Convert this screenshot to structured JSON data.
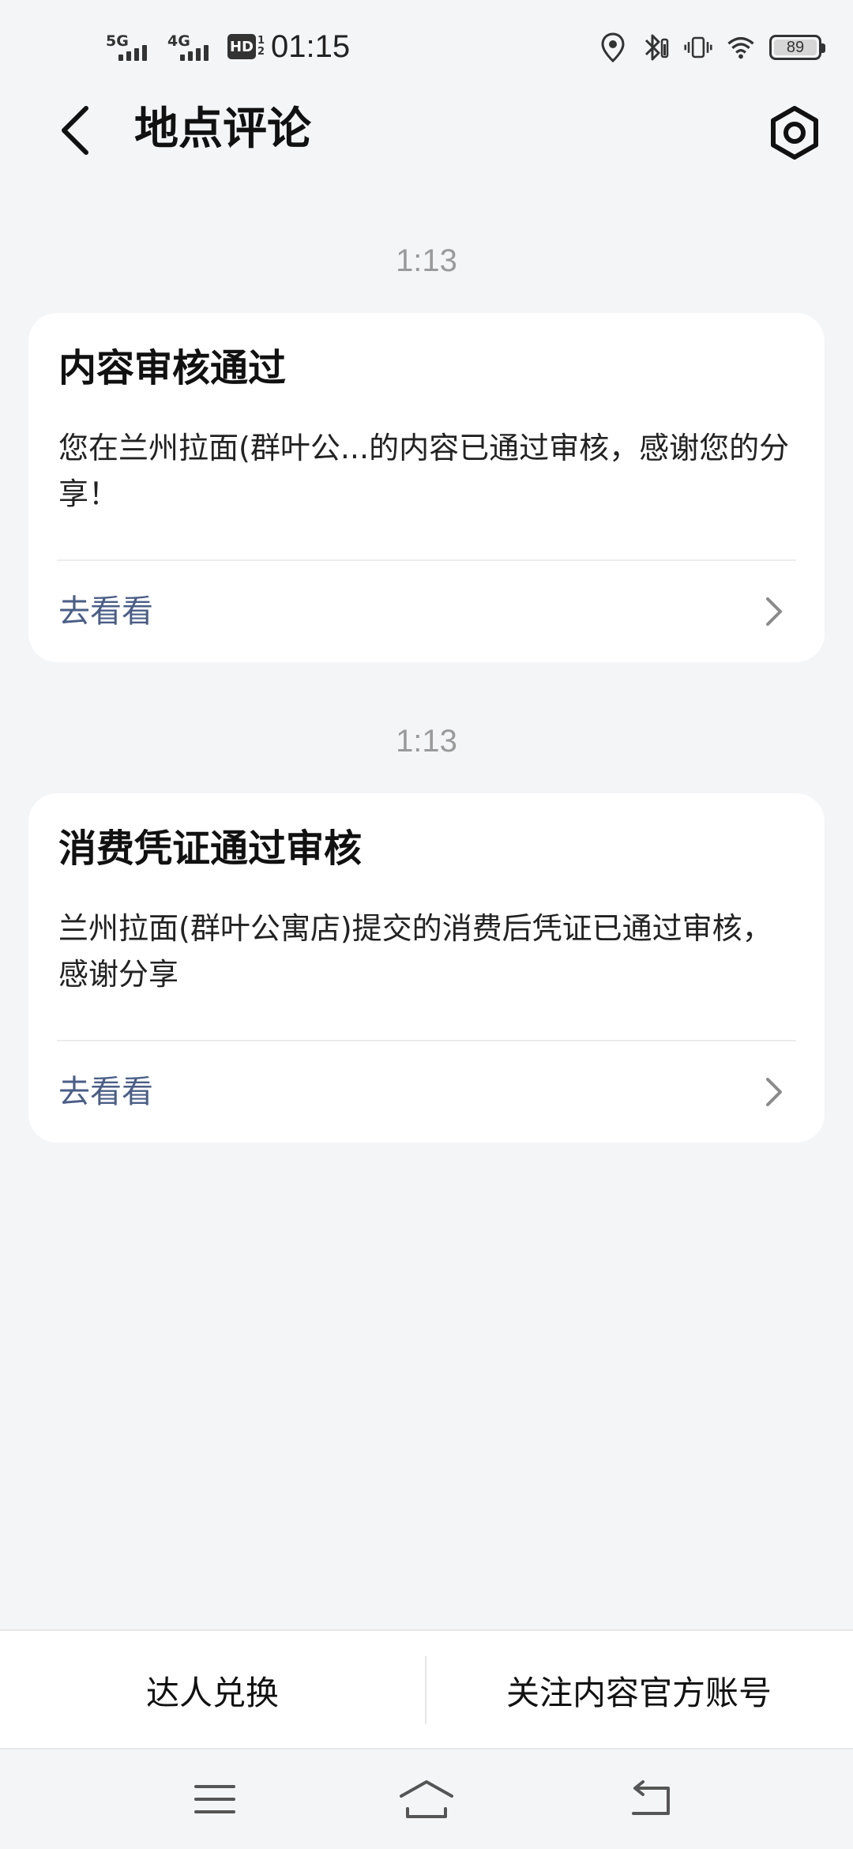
{
  "status_bar": {
    "network_1": "5G",
    "network_2": "4G",
    "hd_label": "HD",
    "hd_sub_top": "1",
    "hd_sub_bottom": "2",
    "time": "01:15",
    "battery": "89",
    "icons": [
      "location-icon",
      "bluetooth-icon",
      "vibrate-icon",
      "wifi-icon",
      "battery-icon"
    ]
  },
  "header": {
    "title": "地点评论",
    "back_icon": "back-arrow-icon",
    "settings_icon": "settings-hex-icon"
  },
  "messages": [
    {
      "time": "1:13",
      "title": "内容审核通过",
      "body": "您在兰州拉面(群叶公...的内容已通过审核，感谢您的分享！",
      "link": "去看看"
    },
    {
      "time": "1:13",
      "title": "消费凭证通过审核",
      "body": "兰州拉面(群叶公寓店)提交的消费后凭证已通过审核，感谢分享",
      "link": "去看看"
    }
  ],
  "bottom_bar": {
    "left_label": "达人兑换",
    "right_label": "关注内容官方账号"
  },
  "system_nav": {
    "icons": [
      "menu-icon",
      "home-icon",
      "back-icon"
    ]
  },
  "colors": {
    "background": "#f4f5f7",
    "card": "#ffffff",
    "link": "#4a5e86",
    "timestamp": "#9a9a9a"
  }
}
